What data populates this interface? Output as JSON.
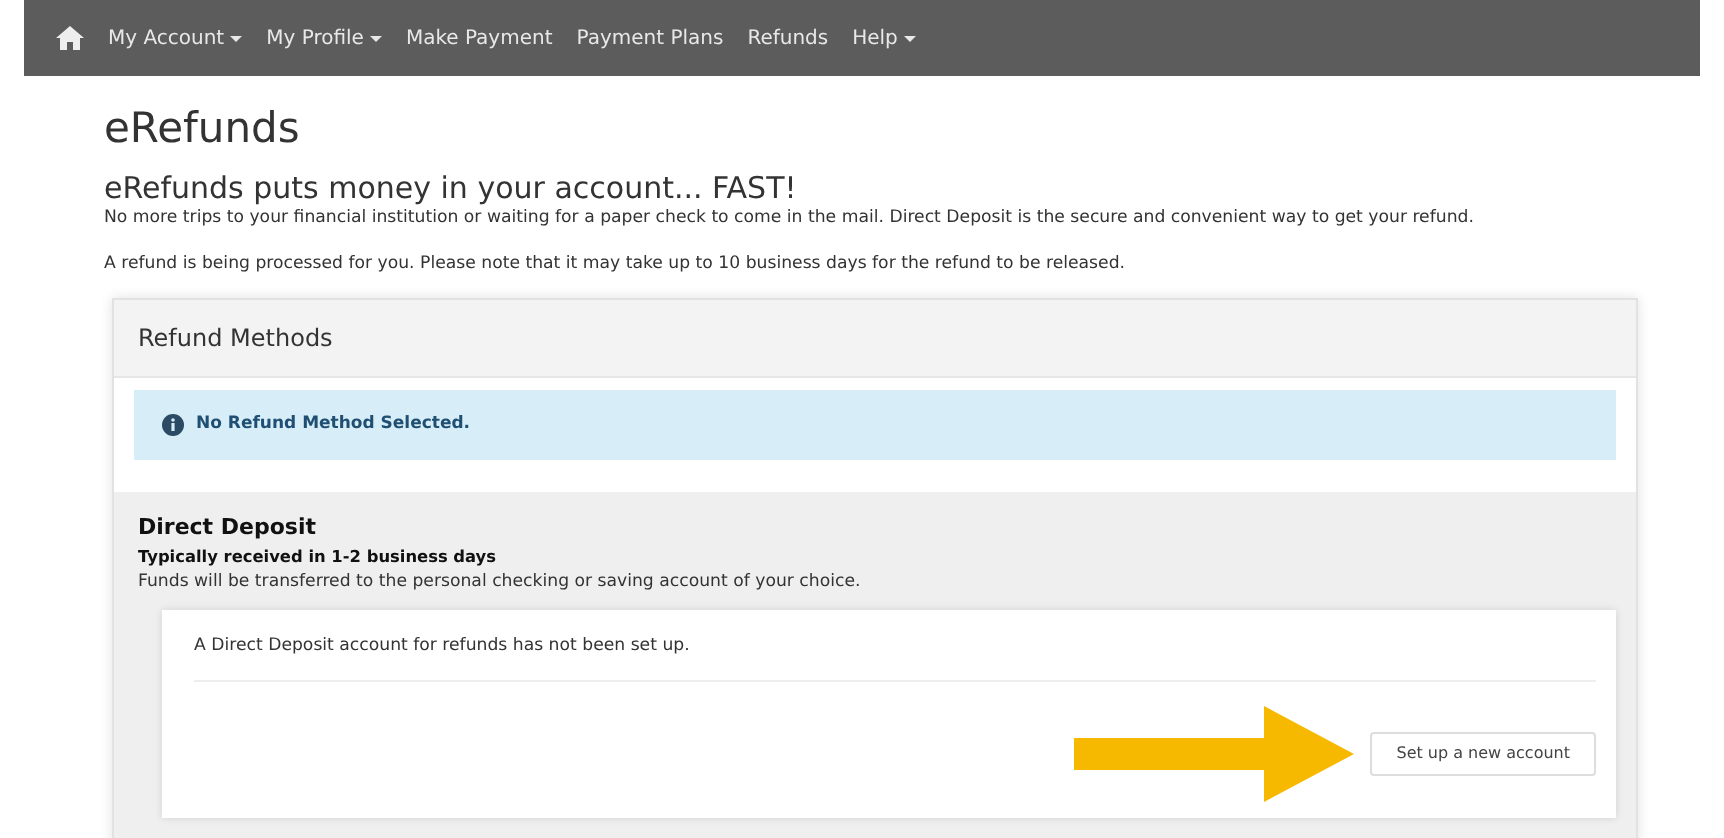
{
  "navbar": {
    "items": [
      {
        "label": "My Account",
        "dropdown": true
      },
      {
        "label": "My Profile",
        "dropdown": true
      },
      {
        "label": "Make Payment",
        "dropdown": false
      },
      {
        "label": "Payment Plans",
        "dropdown": false
      },
      {
        "label": "Refunds",
        "dropdown": false
      },
      {
        "label": "Help",
        "dropdown": true
      }
    ]
  },
  "page_title": "eRefunds",
  "headline": "eRefunds puts money in your account... FAST!",
  "intro": "No more trips to your financial institution or waiting for a paper check to come in the mail. Direct Deposit is the secure and convenient way to get your refund.",
  "notice": "A refund is being processed for you. Please note that it may take up to 10 business days for the refund to be released.",
  "refund_methods": {
    "title": "Refund Methods",
    "alert": "No Refund Method Selected.",
    "direct_deposit": {
      "title": "Direct Deposit",
      "subtitle": "Typically received in 1-2 business days",
      "description": "Funds will be transferred to the personal checking or saving account of your choice.",
      "status": "A Direct Deposit account for refunds has not been set up.",
      "button": "Set up a new account"
    }
  }
}
